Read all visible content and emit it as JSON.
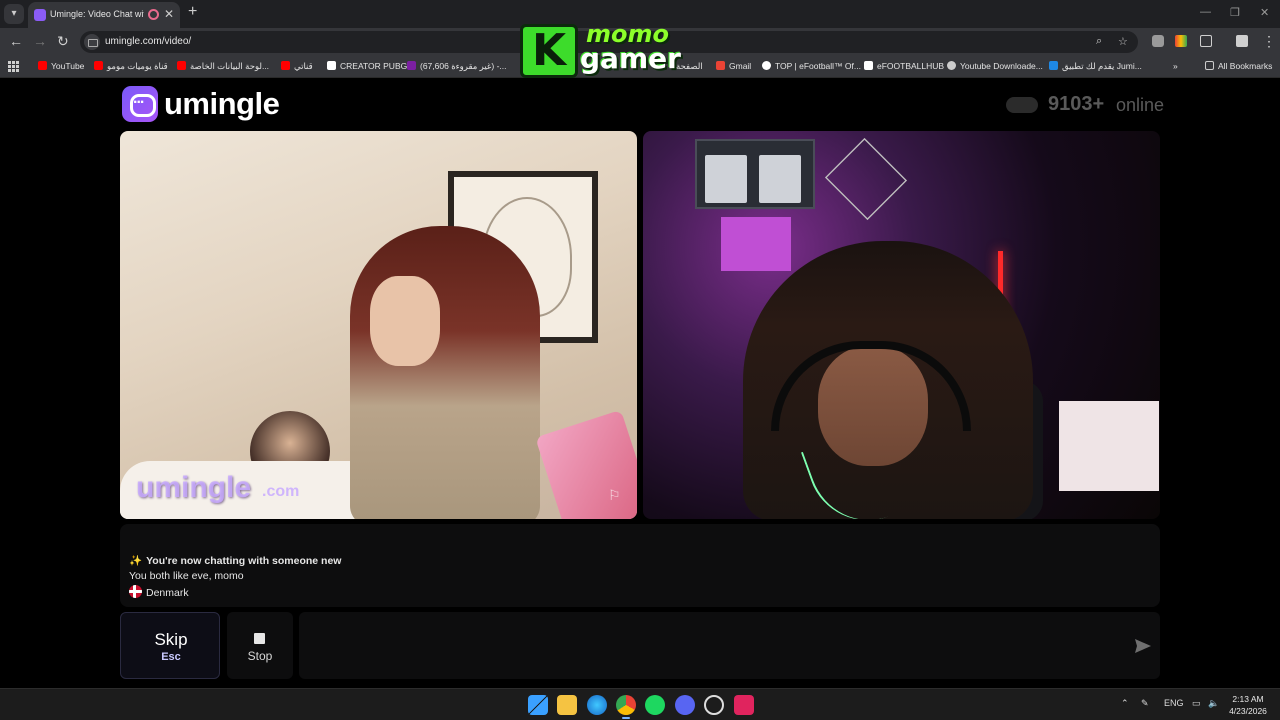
{
  "browser": {
    "tab_title": "Umingle: Video Chat with S",
    "url": "umingle.com/video/",
    "close_glyph": "✕",
    "new_tab_glyph": "+",
    "window_controls": [
      "—",
      "❐",
      "✕"
    ],
    "bookmarks": [
      {
        "label": "YouTube",
        "color": "#ff0000"
      },
      {
        "label": "قناة يوميات مومو",
        "color": "#ff0000"
      },
      {
        "label": "لوحة البيانات الخاصة...",
        "color": "#ff0000"
      },
      {
        "label": "قناتي",
        "color": "#ff0000"
      },
      {
        "label": "CREATOR PUBG",
        "color": "#ffffff"
      },
      {
        "label": "(67,606 غير مقروءة) -...",
        "color": "#7b1fa2"
      },
      {
        "label": "الصفحة",
        "color": "#ff0000"
      },
      {
        "label": "Gmail",
        "color": "#ea4335"
      },
      {
        "label": "TOP | eFootball™ Of...",
        "color": "#ffffff"
      },
      {
        "label": "eFOOTBALLHUB",
        "color": "#ffffff"
      },
      {
        "label": "Youtube Downloade...",
        "color": "#cccccc"
      },
      {
        "label": "يقدم لك تطبيق Jumi...",
        "color": "#1e88e5"
      }
    ],
    "all_bookmarks": "All Bookmarks"
  },
  "overlay": {
    "k": "K",
    "line1": "momo",
    "line2": "gamer"
  },
  "site": {
    "brand": "umingle",
    "online_count": "9103+",
    "online_label": "online"
  },
  "video": {
    "watermark": "umingle",
    "watermark_suffix": ".com"
  },
  "chat": {
    "system_message": "You're now chatting with someone new",
    "interests": "You both like eve, momo",
    "country": "Denmark"
  },
  "controls": {
    "skip_label": "Skip",
    "skip_key": "Esc",
    "stop_label": "Stop",
    "input_placeholder": ""
  },
  "taskbar": {
    "language": "ENG",
    "time": "2:13 AM",
    "date": "4/23/2026",
    "apps": [
      {
        "name": "windows-start-icon",
        "color": "#3aa0ff"
      },
      {
        "name": "file-explorer-icon",
        "color": "#f5c342"
      },
      {
        "name": "edge-icon",
        "color": "#1fa0e0"
      },
      {
        "name": "chrome-icon",
        "color": "#e94235"
      },
      {
        "name": "spotify-icon",
        "color": "#1ed760"
      },
      {
        "name": "discord-icon",
        "color": "#5865f2"
      },
      {
        "name": "obs-icon",
        "color": "#dddddd"
      },
      {
        "name": "app-red-icon",
        "color": "#e0245e"
      }
    ]
  },
  "colors": {
    "accent": "#8b5cf6",
    "page_bg": "#000000",
    "panel_bg": "#0d0d0e"
  }
}
